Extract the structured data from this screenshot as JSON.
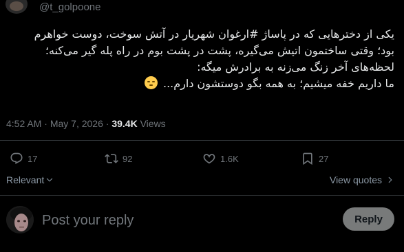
{
  "author": {
    "handle": "@t_golpoone"
  },
  "tweet": {
    "lines": [
      "یکی از دخترهایی که در پاساژ #ارغوان شهریار در آتش سوخت، دوست خواهرم",
      "بود؛ وقتی ساختمون اتیش می‌گیره، پشت در پشت بوم در راه پله گیر می‌کنه؛",
      "لحظه‌های آخر زنگ می‌زنه به برادرش میگه:",
      "ما داریم خفه میشیم؛ به همه بگو دوستشون دارم..."
    ],
    "emoji": "pensive-face"
  },
  "meta": {
    "time": "4:52 AM",
    "separator": "·",
    "date": "May 7, 2026",
    "views_count": "39.4K",
    "views_label": "Views"
  },
  "actions": {
    "replies": "17",
    "reposts": "92",
    "likes": "1.6K",
    "bookmarks": "27"
  },
  "sort": {
    "relevant_label": "Relevant",
    "view_quotes_label": "View quotes"
  },
  "reply": {
    "placeholder": "Post your reply",
    "button_label": "Reply"
  },
  "colors": {
    "background": "#000000",
    "text": "#e7e9ea",
    "secondary": "#71767b",
    "divider": "#2f3336",
    "reply_button": "#787a7a"
  }
}
